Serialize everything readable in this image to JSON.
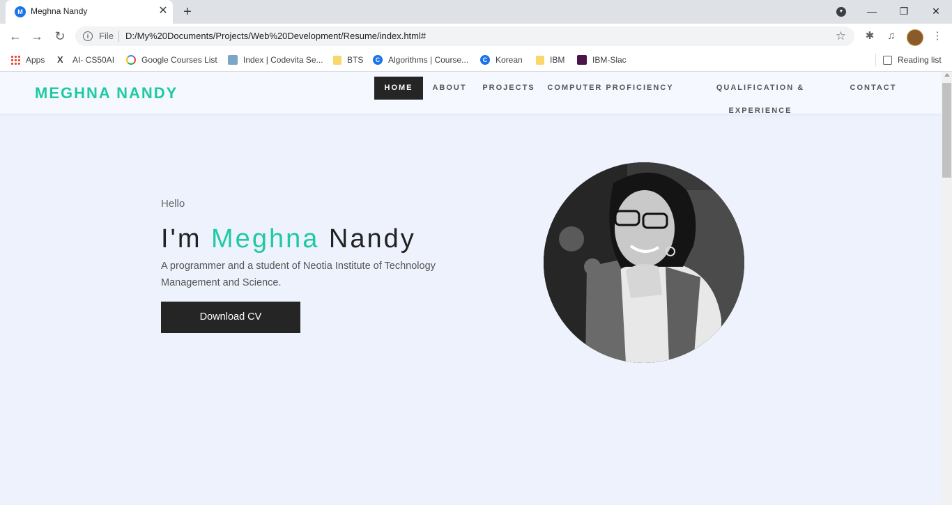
{
  "browser": {
    "tab": {
      "title": "Meghna Nandy",
      "favicon_letter": "M"
    },
    "omnibox": {
      "scheme_label": "File",
      "url": "D:/My%20Documents/Projects/Web%20Development/Resume/index.html#"
    },
    "bookmarks": [
      {
        "label": "Apps",
        "icon": "apps-grid-icon"
      },
      {
        "label": "AI- CS50AI",
        "icon": "x-icon"
      },
      {
        "label": "Google Courses List",
        "icon": "google-icon"
      },
      {
        "label": "Index | Codevita Se...",
        "icon": "codevita-icon"
      },
      {
        "label": "BTS",
        "icon": "folder-icon"
      },
      {
        "label": "Algorithms | Course...",
        "icon": "coursera-icon"
      },
      {
        "label": "Korean",
        "icon": "coursera-icon"
      },
      {
        "label": "IBM",
        "icon": "folder-icon"
      },
      {
        "label": "IBM-Slac",
        "icon": "slack-icon"
      }
    ],
    "reading_list": "Reading list"
  },
  "site": {
    "logo": "MEGHNA NANDY",
    "nav": [
      "HOME",
      "ABOUT",
      "PROJECTS",
      "COMPUTER PROFICIENCY",
      "QUALIFICATION & EXPERIENCE",
      "CONTACT"
    ],
    "active_nav": "HOME",
    "accent_color": "#1fc9a4"
  },
  "hero": {
    "greeting": "Hello",
    "headline_prefix": "I'm",
    "first_name": "Meghna",
    "last_name": "Nandy",
    "description": "A programmer and a student of Neotia Institute of Technology Management and Science.",
    "cta_label": "Download CV"
  }
}
